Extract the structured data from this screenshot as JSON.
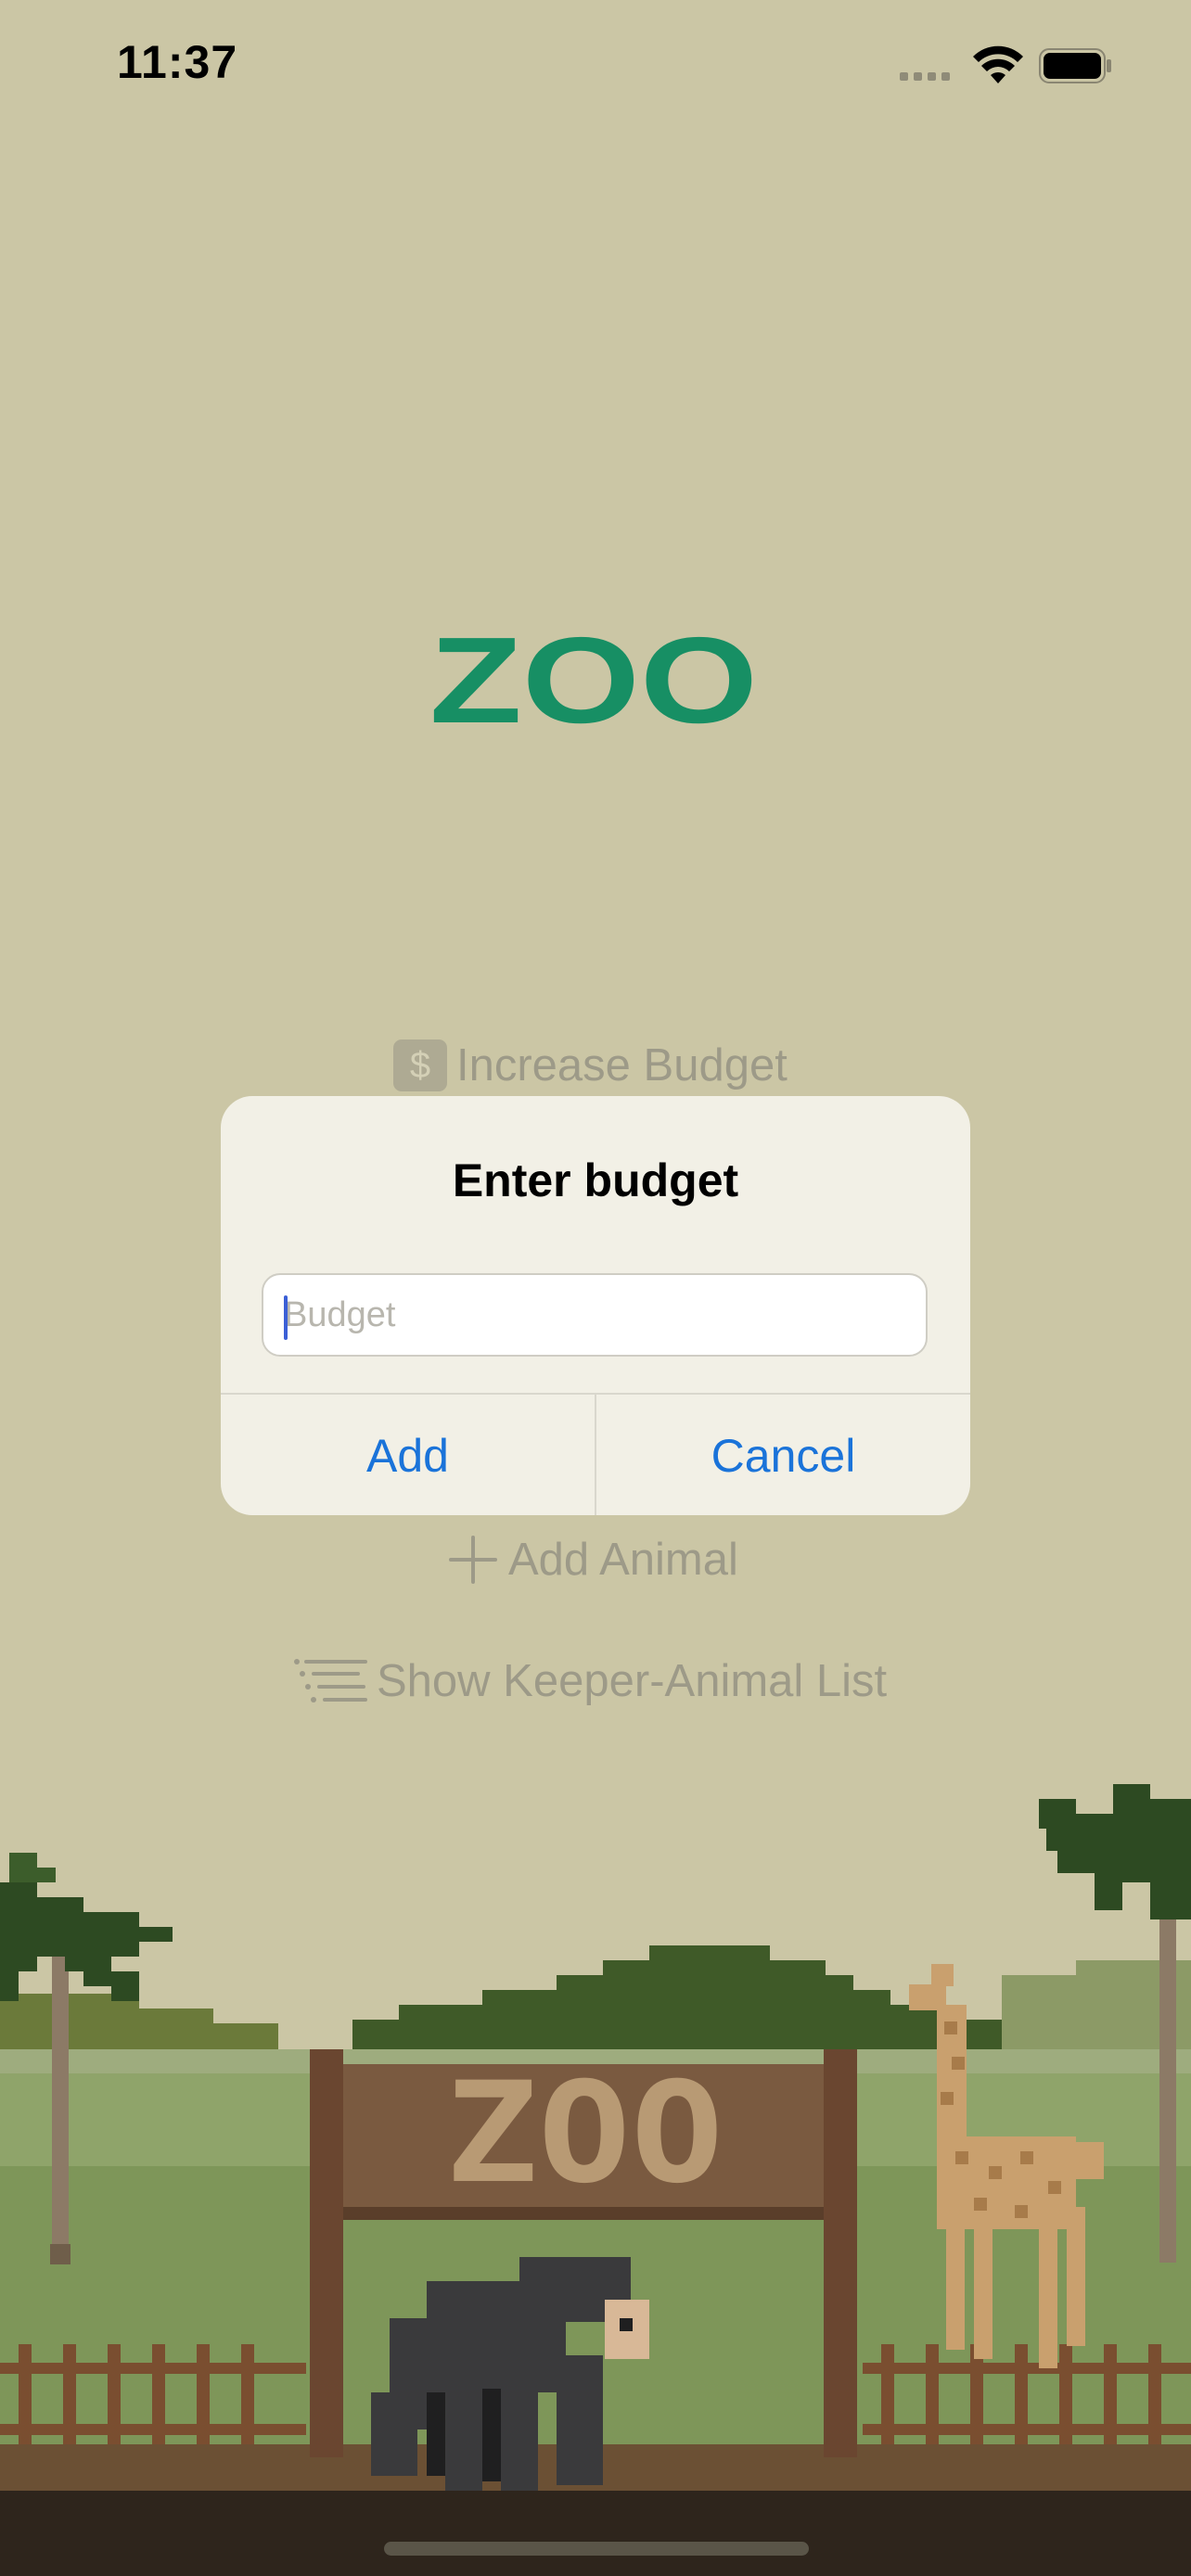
{
  "status_bar": {
    "time": "11:37",
    "icons": [
      "cellular-signal-icon",
      "wifi-icon",
      "battery-icon"
    ]
  },
  "logo": {
    "text": "ZOO",
    "color": "#178f64"
  },
  "menu": {
    "increase_budget": "Increase Budget",
    "add_animal": "Add Animal",
    "show_list": "Show Keeper-Animal List"
  },
  "dialog": {
    "title": "Enter budget",
    "input_placeholder": "Budget",
    "input_value": "",
    "add_label": "Add",
    "cancel_label": "Cancel"
  },
  "scene": {
    "sign_text": "ZOO"
  },
  "colors": {
    "background": "#cbc6a5",
    "accent": "#1a73d9",
    "brand": "#178f64"
  }
}
